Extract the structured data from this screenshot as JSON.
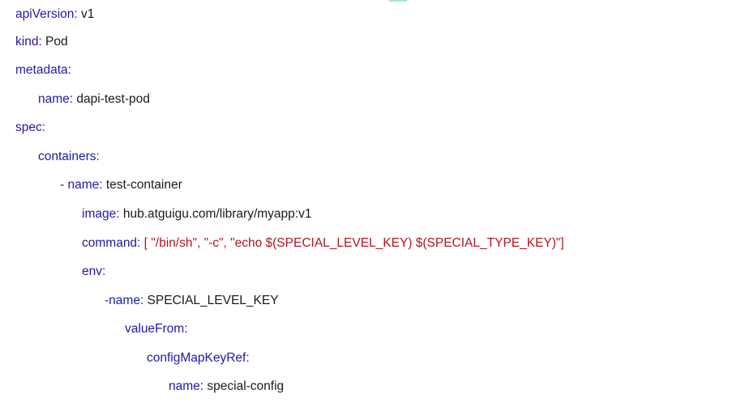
{
  "document": {
    "lines": [
      {
        "key": "apiVersion:",
        "value": " v1"
      },
      {
        "key": "kind:",
        "value": " Pod"
      },
      {
        "key": "metadata:",
        "value": ""
      },
      {
        "key": "name:",
        "value": " dapi-test-pod"
      },
      {
        "key": "spec:",
        "value": ""
      },
      {
        "key": "containers:",
        "value": ""
      },
      {
        "key": "- name:",
        "value": " test-container"
      },
      {
        "key": "image:",
        "value": " hub.atguigu.com/library/myapp:v1"
      },
      {
        "key": "command:",
        "value": " [ \"/bin/sh\", \"-c\", \"echo $(SPECIAL_LEVEL_KEY) $(SPECIAL_TYPE_KEY)\"]"
      },
      {
        "key": "env:",
        "value": ""
      },
      {
        "key": "-name:",
        "value": " SPECIAL_LEVEL_KEY"
      },
      {
        "key": "valueFrom:",
        "value": ""
      },
      {
        "key": "configMapKeyRef:",
        "value": ""
      },
      {
        "key": "name:",
        "value": " special-config"
      }
    ]
  },
  "colors": {
    "key": "#1f1aa6",
    "value": "#1a1a1a",
    "string": "#b3151d",
    "watermark": "#5fc8c0"
  }
}
